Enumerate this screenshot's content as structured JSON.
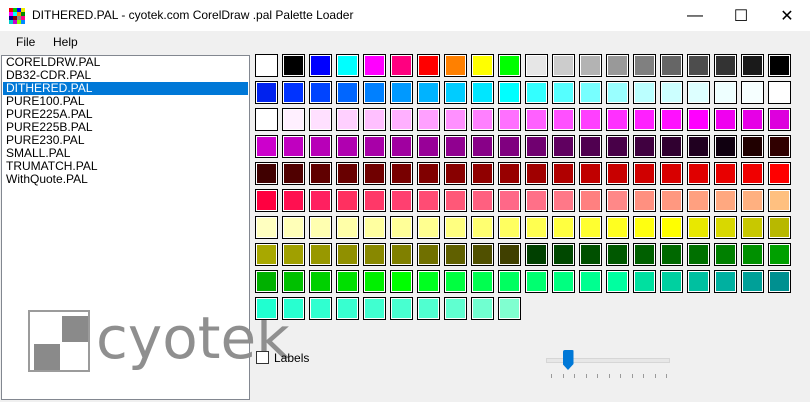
{
  "window": {
    "title": "DITHERED.PAL - cyotek.com CorelDraw .pal Palette Loader",
    "minimize": "—",
    "maximize": "☐",
    "close": "✕"
  },
  "menu": {
    "file": "File",
    "help": "Help"
  },
  "files": [
    "CORELDRW.PAL",
    "DB32-CDR.PAL",
    "DITHERED.PAL",
    "PURE100.PAL",
    "PURE225A.PAL",
    "PURE225B.PAL",
    "PURE230.PAL",
    "SMALL.PAL",
    "TRUMATCH.PAL",
    "WithQuote.PAL"
  ],
  "selected_index": 2,
  "labels_checkbox": {
    "label": "Labels",
    "checked": false
  },
  "slider": {
    "position_fraction": 0.15
  },
  "logo_text": "cyotek",
  "palette": [
    [
      "#ffffff",
      "#000000",
      "#0000ff",
      "#00ffff",
      "#ff00ff",
      "#ff0080",
      "#ff0000",
      "#ff8000",
      "#ffff00",
      "#00ff00",
      "#e6e6e6",
      "#cccccc",
      "#b3b3b3",
      "#999999",
      "#808080",
      "#666666",
      "#4d4d4d",
      "#333333",
      "#1a1a1a",
      "#000000"
    ],
    [
      "#0022ee",
      "#0033ff",
      "#0044ff",
      "#0066ff",
      "#0080ff",
      "#0099ff",
      "#00b3ff",
      "#00ccff",
      "#00e6ff",
      "#00ffff",
      "#33ffff",
      "#55ffff",
      "#77ffff",
      "#99ffff",
      "#bbffff",
      "#ccffff",
      "#ddffff",
      "#eeffff",
      "#f6ffff",
      "#ffffff"
    ],
    [
      "#ffffff",
      "#fff0ff",
      "#ffe0ff",
      "#ffd0ff",
      "#ffc0ff",
      "#ffb0ff",
      "#ffa0ff",
      "#ff90ff",
      "#ff80ff",
      "#ff70ff",
      "#ff60ff",
      "#ff50ff",
      "#ff40ff",
      "#ff30ff",
      "#ff20ff",
      "#ff10ff",
      "#ff00ff",
      "#f000f0",
      "#e600e6",
      "#dd00dd"
    ],
    [
      "#cc00cc",
      "#c000c0",
      "#b800b8",
      "#b000b0",
      "#a800a8",
      "#a000a0",
      "#980098",
      "#900090",
      "#880088",
      "#800080",
      "#700070",
      "#600060",
      "#500050",
      "#480048",
      "#400040",
      "#300030",
      "#200020",
      "#100010",
      "#200000",
      "#300000"
    ],
    [
      "#400000",
      "#500000",
      "#600000",
      "#680000",
      "#700000",
      "#780000",
      "#800000",
      "#880000",
      "#900000",
      "#980000",
      "#a00000",
      "#b00000",
      "#c00000",
      "#c80000",
      "#d00000",
      "#d80000",
      "#e00000",
      "#e80000",
      "#f00000",
      "#ff0000"
    ],
    [
      "#ff0040",
      "#ff1050",
      "#ff2060",
      "#ff3060",
      "#ff3868",
      "#ff4070",
      "#ff4c74",
      "#ff5878",
      "#ff6080",
      "#ff6888",
      "#ff7088",
      "#ff7888",
      "#ff8080",
      "#ff8888",
      "#ff9080",
      "#ff9880",
      "#ffa080",
      "#ffa880",
      "#ffb080",
      "#ffc080"
    ],
    [
      "#ffffc0",
      "#ffffb8",
      "#ffffb0",
      "#ffffa8",
      "#ffffa0",
      "#ffff98",
      "#ffff90",
      "#ffff80",
      "#ffff70",
      "#ffff60",
      "#ffff50",
      "#ffff40",
      "#ffff30",
      "#ffff20",
      "#ffff10",
      "#ffff00",
      "#e8e800",
      "#d8d800",
      "#c8c800",
      "#b8b800"
    ],
    [
      "#a8a800",
      "#a0a000",
      "#989800",
      "#909000",
      "#888800",
      "#808000",
      "#707000",
      "#606000",
      "#505000",
      "#404000",
      "#004000",
      "#004800",
      "#005000",
      "#005800",
      "#006000",
      "#006800",
      "#007000",
      "#008000",
      "#009000",
      "#00a000"
    ],
    [
      "#00b000",
      "#00c000",
      "#00d000",
      "#00e000",
      "#00f000",
      "#00ff00",
      "#00ff20",
      "#00ff40",
      "#00ff50",
      "#00ff60",
      "#00ff70",
      "#00ff80",
      "#00ff90",
      "#00ffa0",
      "#00e0a0",
      "#00d0a0",
      "#00c0a0",
      "#00b0a0",
      "#00a098",
      "#009090"
    ],
    [
      "#20ffd0",
      "#28ffd0",
      "#30ffd0",
      "#38ffd0",
      "#40ffd0",
      "#48ffd0",
      "#50ffd0",
      "#60ffd0",
      "#70ffd0",
      "#80ffd0"
    ]
  ]
}
